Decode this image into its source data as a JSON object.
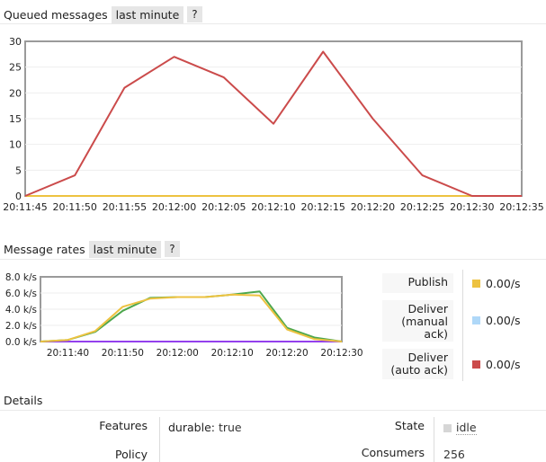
{
  "queued": {
    "title": "Queued messages",
    "range_label": "last minute",
    "help_label": "?"
  },
  "rates": {
    "title": "Message rates",
    "range_label": "last minute",
    "help_label": "?",
    "legend": [
      {
        "label_lines": [
          "Publish"
        ],
        "value": "0.00/s",
        "color": "#edc240"
      },
      {
        "label_lines": [
          "Deliver",
          "(manual",
          "ack)"
        ],
        "value": "0.00/s",
        "color": "#afd8f8"
      },
      {
        "label_lines": [
          "Deliver",
          "(auto ack)"
        ],
        "value": "0.00/s",
        "color": "#cb4b4b"
      }
    ]
  },
  "details": {
    "title": "Details",
    "features_label": "Features",
    "features_key": "durable:",
    "features_value": "true",
    "policy_label": "Policy",
    "state_label": "State",
    "state_value": "idle",
    "consumers_label": "Consumers",
    "consumers_value": "256"
  },
  "chart_data": [
    {
      "type": "line",
      "x": [
        "20:11:45",
        "20:11:50",
        "20:11:55",
        "20:12:00",
        "20:12:05",
        "20:12:10",
        "20:12:15",
        "20:12:20",
        "20:12:25",
        "20:12:30",
        "20:12:35"
      ],
      "xticks": [
        "20:11:45",
        "20:11:50",
        "20:11:55",
        "20:12:00",
        "20:12:05",
        "20:12:10",
        "20:12:15",
        "20:12:20",
        "20:12:25",
        "20:12:30",
        "20:12:35"
      ],
      "yticks": [
        "0",
        "5",
        "10",
        "15",
        "20",
        "25",
        "30"
      ],
      "ylim": [
        0,
        30
      ],
      "series": [
        {
          "color": "#cb4b4b",
          "values": [
            0,
            4,
            21,
            27,
            23,
            14,
            28,
            15,
            4,
            0,
            0
          ]
        },
        {
          "color": "#edc240",
          "values": [
            0,
            0,
            0,
            0,
            0,
            0,
            0,
            0,
            0,
            0,
            0
          ]
        }
      ]
    },
    {
      "type": "line",
      "x": [
        "20:11:35",
        "20:11:40",
        "20:11:45",
        "20:11:50",
        "20:11:55",
        "20:12:00",
        "20:12:05",
        "20:12:10",
        "20:12:15",
        "20:12:20",
        "20:12:25",
        "20:12:30"
      ],
      "xticks": [
        "20:11:40",
        "20:11:50",
        "20:12:00",
        "20:12:10",
        "20:12:20",
        "20:12:30"
      ],
      "yticks": [
        "0.0 k/s",
        "2.0 k/s",
        "4.0 k/s",
        "6.0 k/s",
        "8.0 k/s"
      ],
      "ylim": [
        0,
        8
      ],
      "series": [
        {
          "color": "#edc240",
          "values": [
            0,
            0.2,
            1.3,
            4.3,
            5.3,
            5.5,
            5.5,
            5.8,
            5.7,
            1.5,
            0.3,
            0
          ]
        },
        {
          "color": "#4da74d",
          "values": [
            0,
            0.2,
            1.2,
            3.8,
            5.4,
            5.5,
            5.5,
            5.8,
            6.2,
            1.7,
            0.5,
            0
          ]
        },
        {
          "color": "#9440ed",
          "values": [
            0,
            0,
            0,
            0,
            0,
            0,
            0,
            0,
            0,
            0,
            0,
            0
          ]
        },
        {
          "color": "#cb4b4b",
          "values": [
            0,
            0,
            0,
            0,
            0,
            0,
            0,
            0,
            0,
            0,
            0,
            0
          ]
        },
        {
          "color": "#afd8f8",
          "values": [
            0,
            0,
            0,
            0,
            0,
            0,
            0,
            0,
            0,
            0,
            0,
            0
          ]
        }
      ]
    }
  ]
}
